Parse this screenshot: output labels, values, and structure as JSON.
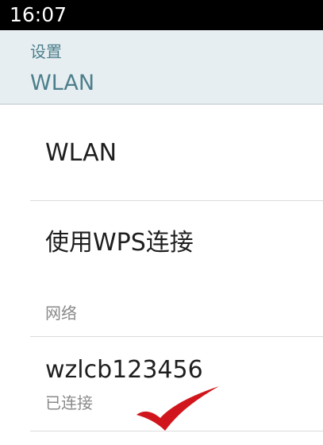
{
  "status_bar": {
    "time": "16:07"
  },
  "header": {
    "subtitle": "设置",
    "title": "WLAN"
  },
  "settings": {
    "wlan_toggle_label": "WLAN",
    "wps_label": "使用WPS连接",
    "section_networks": "网络"
  },
  "networks": [
    {
      "ssid": "wzlcb123456",
      "status": "已连接"
    }
  ],
  "colors": {
    "accent": "#4d7f8c",
    "header_bg": "#e6eef1",
    "checkmark": "#d0161c"
  }
}
